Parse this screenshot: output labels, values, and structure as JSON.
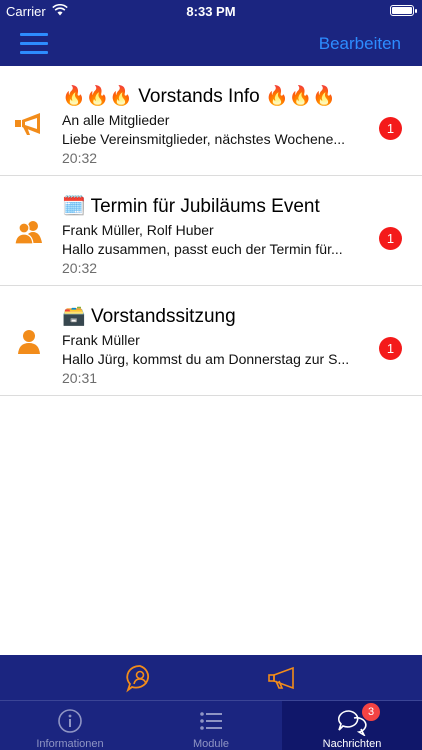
{
  "status_bar": {
    "carrier": "Carrier",
    "time": "8:33 PM"
  },
  "nav": {
    "edit_label": "Bearbeiten"
  },
  "messages": [
    {
      "title_prefix": "🔥🔥🔥",
      "title": "Vorstands Info",
      "title_suffix": "🔥🔥🔥",
      "recipients": "An alle Mitglieder",
      "preview": "Liebe Vereinsmitglieder, nächstes Wochene...",
      "time": "20:32",
      "unread": "1",
      "icon": "megaphone-icon"
    },
    {
      "title_prefix": "🗓️",
      "title": "Termin für Jubiläums Event",
      "recipients": "Frank Müller, Rolf Huber",
      "preview": "Hallo zusammen, passt euch der Termin für...",
      "time": "20:32",
      "unread": "1",
      "icon": "group-icon"
    },
    {
      "title_prefix": "🗃️",
      "title": "Vorstandssitzung",
      "recipients": "Frank Müller",
      "preview": "Hallo Jürg, kommst du am Donnerstag zur S...",
      "time": "20:31",
      "unread": "1",
      "icon": "person-icon"
    }
  ],
  "tabs": [
    {
      "label": "Informationen",
      "icon": "info-icon"
    },
    {
      "label": "Module",
      "icon": "list-icon"
    },
    {
      "label": "Nachrichten",
      "icon": "chat-icon",
      "badge": "3"
    }
  ],
  "colors": {
    "navy": "#1b2580",
    "accent_blue": "#2d8cff",
    "orange": "#f28c1a",
    "badge_red": "#f41a1a"
  }
}
